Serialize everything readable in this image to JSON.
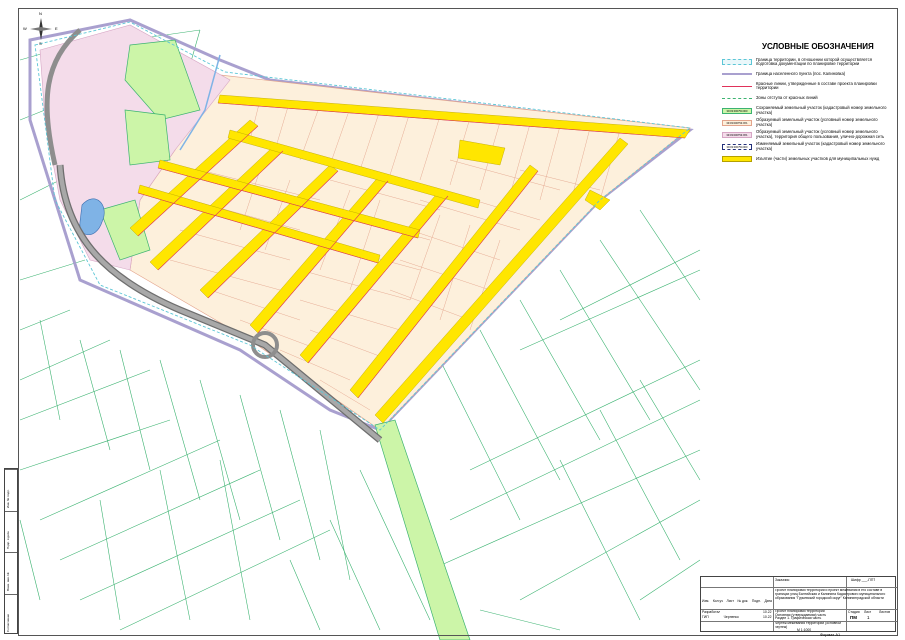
{
  "legend": {
    "title": "УСЛОВНЫЕ ОБОЗНАЧЕНИЯ",
    "items": [
      {
        "text": "Граница территории, в отношении которой осуществляется подготовка документации по планировке территории",
        "swatch": "dashed-cyan",
        "code": ""
      },
      {
        "text": "Граница населенного пункта (пос. Калиновка)",
        "swatch": "outline-lavender",
        "code": ""
      },
      {
        "text": "Красные линии, утвержденные в составе проекта планировки территории",
        "swatch": "line-red",
        "code": ""
      },
      {
        "text": "Зоны отступа от красных линий",
        "swatch": "line-green-dashed",
        "code": ""
      },
      {
        "text": "Сохраняемый земельный участок (кадастровый номер земельного участка)",
        "swatch": "fill-green",
        "code": "39:03:000754:000"
      },
      {
        "text": "Образуемый земельный участок (условный номер земельного участка)",
        "swatch": "fill-peach",
        "code": "39:03:000754:ЗУ1"
      },
      {
        "text": "Образуемый земельный участок (условный номер земельного участка), территория общего пользования, улично-дорожная сеть",
        "swatch": "fill-pink",
        "code": "39:03:000754:ЗУ1"
      },
      {
        "text": "Изменяемый земельный участок (кадастровый номер земельного участка)",
        "swatch": "dashed-navy",
        "code": "39:03:000754:000"
      },
      {
        "text": "Изъятие (части) земельных участков для муниципальных нужд",
        "swatch": "fill-yellow",
        "code": ""
      }
    ]
  },
  "stamp": {
    "header": "Заказчик:",
    "code": "Шифр ___-ППТ",
    "description": "Проект планировки территории и проект межевания в его составе в границах улиц Балтийская и Калинина Кадастрового муниципального образования \"Гурьевский городской округ\" Калининградской области",
    "roles": [
      {
        "role": "Разработал",
        "name": ""
      },
      {
        "role": "ГИП",
        "name": "Черненко"
      }
    ],
    "dates": [
      "10.22",
      "10.22"
    ],
    "col_headers": [
      "Изм.",
      "Кол.уч",
      "Лист",
      "№ док.",
      "Подп.",
      "Дата"
    ],
    "title_lines": [
      "Проект планировки территории",
      "Основная (утверждаемая) часть",
      "Раздел 1. Графическая часть"
    ],
    "stage_label": "Стадия",
    "stage": "ПМ",
    "sheet_label": "Лист",
    "sheet": "1",
    "sheets_label": "Листов",
    "sheets": "",
    "drawing_name": "Чертеж межевания территории (основной чертеж)",
    "scale": "М 1:1000"
  },
  "side_stamp": [
    "Инв. № подл.",
    "Подп. и дата",
    "Взам. инв. №",
    "Согласовано"
  ],
  "format": "Формат А1",
  "compass": {
    "n": "N",
    "s": "S",
    "e": "E",
    "w": "W"
  },
  "colors": {
    "yellow": "#ffe600",
    "peach": "#fdf0dc",
    "pink": "#f4dcea",
    "green": "#ccf5a8",
    "lavender": "#a9a0cf",
    "road": "#8e8e8e",
    "water": "#7fb3e6",
    "parcel": "#e3a48c",
    "neighbour": "#3cb371",
    "red": "#e0325a"
  }
}
